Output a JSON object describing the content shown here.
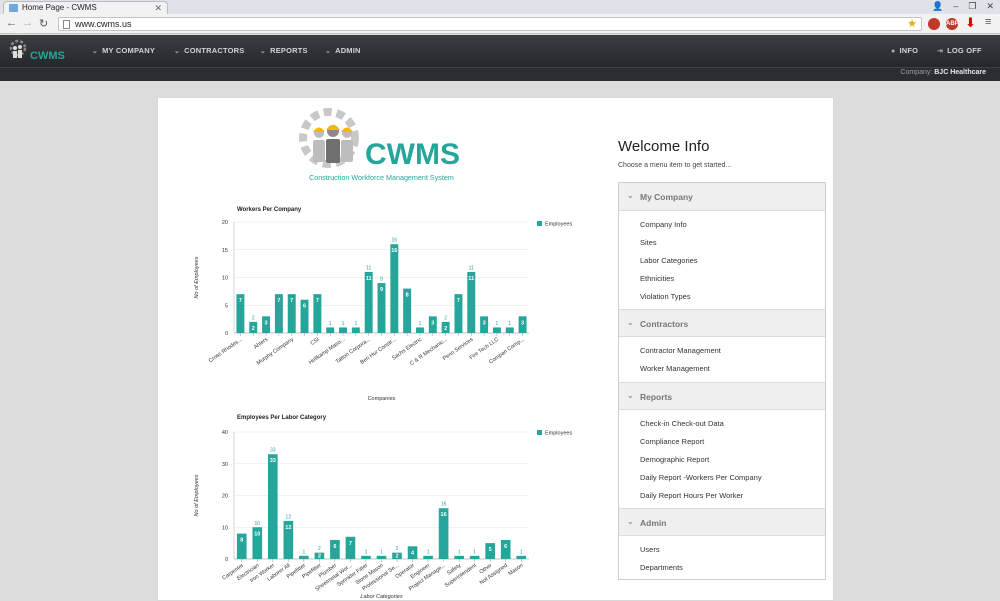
{
  "browser": {
    "tab_title": "Home Page - CWMS",
    "url": "www.cwms.us",
    "ext_abp": "ABP"
  },
  "nav": {
    "logo_text": "CWMS",
    "menu": [
      "MY COMPANY",
      "CONTRACTORS",
      "REPORTS",
      "ADMIN"
    ],
    "info": "INFO",
    "logoff": "LOG OFF",
    "company_label": "Company:",
    "company_name": "BJC Healthcare"
  },
  "logo": {
    "title": "CWMS",
    "tagline": "Construction Workforce Management System"
  },
  "welcome": {
    "title": "Welcome Info",
    "subtitle": "Choose a menu item to get started..."
  },
  "menu_sections": [
    {
      "title": "My Company",
      "links": [
        "Company Info",
        "Sites",
        "Labor Categories",
        "Ethnicities",
        "Violation Types"
      ]
    },
    {
      "title": "Contractors",
      "links": [
        "Contractor Management",
        "Worker Management"
      ]
    },
    {
      "title": "Reports",
      "links": [
        "Check-in Check-out Data",
        "Compliance Report",
        "Demographic Report",
        "Daily Report -Workers Per Company",
        "Daily Report Hours Per Worker"
      ]
    },
    {
      "title": "Admin",
      "links": [
        "Users",
        "Departments"
      ]
    }
  ],
  "colors": {
    "bar": "#26a69a",
    "accent": "#26a69a"
  },
  "chart_data": [
    {
      "type": "bar",
      "title": "Workers Per Company",
      "xlabel": "Companies",
      "ylabel": "No of Employees",
      "ylim": [
        0,
        20
      ],
      "yticks": [
        0,
        5,
        10,
        15,
        20
      ],
      "legend": "top-right",
      "series": [
        {
          "name": "Employees",
          "values": [
            7,
            2,
            3,
            7,
            7,
            6,
            7,
            1,
            1,
            1,
            11,
            9,
            16,
            8,
            1,
            3,
            2,
            7,
            11,
            3,
            1,
            1,
            3
          ]
        }
      ],
      "tick_labels": [
        "Cross Rhodes...",
        "",
        "Ahlers",
        "",
        "Murphy Company",
        "",
        "CSI",
        "",
        "Hellkamp Maso...",
        "",
        "Tatton Corpora...",
        "",
        "Ben Hur Constr...",
        "",
        "Sachs Electric",
        "",
        "C & R Mechanic...",
        "",
        "Penn Services",
        "",
        "Fire Tech LLC",
        "",
        "Compan Comp..."
      ]
    },
    {
      "type": "bar",
      "title": "Employees Per Labor Category",
      "xlabel": "Labor Categories",
      "ylabel": "No of Employees",
      "ylim": [
        0,
        40
      ],
      "yticks": [
        0,
        10,
        20,
        30,
        40
      ],
      "legend": "top-right",
      "series": [
        {
          "name": "Employees",
          "values": [
            8,
            10,
            33,
            12,
            1,
            2,
            6,
            7,
            1,
            1,
            2,
            4,
            1,
            16,
            1,
            1,
            5,
            6,
            1
          ]
        }
      ],
      "tick_labels": [
        "Carpenter",
        "Electrician",
        "Iron Worker",
        "Laborer All",
        "Pipefitter",
        "Pipefitter",
        "Plumber",
        "Sheetmetal Wor...",
        "Sprinkler Fitter",
        "Stone Mason",
        "Professional Se...",
        "Operator",
        "Engineer",
        "Project Manage...",
        "Safety",
        "Superintendent",
        "Other",
        "Not Assigned",
        "Mason"
      ]
    }
  ]
}
